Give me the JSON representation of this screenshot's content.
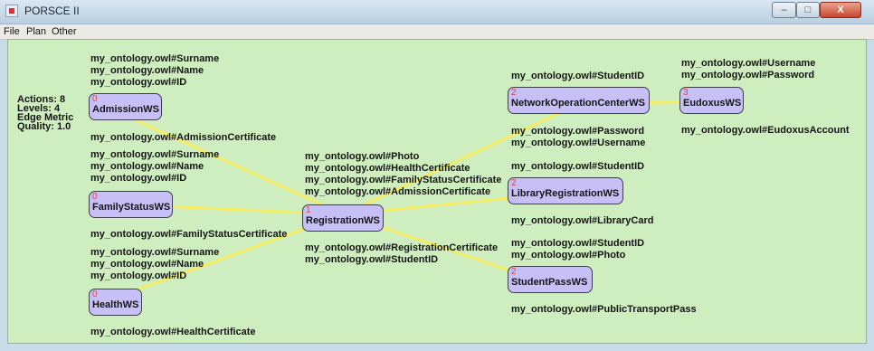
{
  "window": {
    "title": "PORSCE II",
    "controls": {
      "minimize": "–",
      "maximize": "□",
      "close": "X"
    }
  },
  "menu": [
    "File",
    "Plan",
    "Other"
  ],
  "stats": {
    "actions": "Actions: 8",
    "levels": "Levels:  4",
    "edge_metric": "Edge Metric",
    "quality": "Quality: 1.0"
  },
  "colors": {
    "canvas": "#cfeebf",
    "node_fill": "#c6c0f7",
    "edge": "#f4ec62",
    "level_text": "#e8413d"
  },
  "nodes": [
    {
      "id": "admission",
      "level": "0",
      "name": "AdmissionWS"
    },
    {
      "id": "family",
      "level": "0",
      "name": "FamilyStatusWS"
    },
    {
      "id": "health",
      "level": "0",
      "name": "HealthWS"
    },
    {
      "id": "registration",
      "level": "1",
      "name": "RegistrationWS"
    },
    {
      "id": "network",
      "level": "2",
      "name": "NetworkOperationCenterWS"
    },
    {
      "id": "library",
      "level": "2",
      "name": "LibraryRegistrationWS"
    },
    {
      "id": "studentpass",
      "level": "2",
      "name": "StudentPassWS"
    },
    {
      "id": "eudoxus",
      "level": "3",
      "name": "EudoxusWS"
    }
  ],
  "labels": {
    "admission_inputs": [
      "my_ontology.owl#Surname",
      "my_ontology.owl#Name",
      "my_ontology.owl#ID"
    ],
    "admission_outputs": [
      "my_ontology.owl#AdmissionCertificate"
    ],
    "family_inputs": [
      "my_ontology.owl#Surname",
      "my_ontology.owl#Name",
      "my_ontology.owl#ID"
    ],
    "family_outputs": [
      "my_ontology.owl#FamilyStatusCertificate"
    ],
    "health_inputs": [
      "my_ontology.owl#Surname",
      "my_ontology.owl#Name",
      "my_ontology.owl#ID"
    ],
    "health_outputs": [
      "my_ontology.owl#HealthCertificate"
    ],
    "registration_inputs": [
      "my_ontology.owl#Photo",
      "my_ontology.owl#HealthCertificate",
      "my_ontology.owl#FamilyStatusCertificate",
      "my_ontology.owl#AdmissionCertificate"
    ],
    "registration_outputs": [
      "my_ontology.owl#RegistrationCertificate",
      "my_ontology.owl#StudentID"
    ],
    "network_inputs": [
      "my_ontology.owl#StudentID"
    ],
    "network_outputs": [
      "my_ontology.owl#Password",
      "my_ontology.owl#Username"
    ],
    "library_inputs": [
      "my_ontology.owl#StudentID"
    ],
    "library_outputs": [
      "my_ontology.owl#LibraryCard"
    ],
    "studentpass_inputs": [
      "my_ontology.owl#StudentID",
      "my_ontology.owl#Photo"
    ],
    "studentpass_outputs": [
      "my_ontology.owl#PublicTransportPass"
    ],
    "eudoxus_inputs": [
      "my_ontology.owl#Username",
      "my_ontology.owl#Password"
    ],
    "eudoxus_outputs": [
      "my_ontology.owl#EudoxusAccount"
    ]
  }
}
